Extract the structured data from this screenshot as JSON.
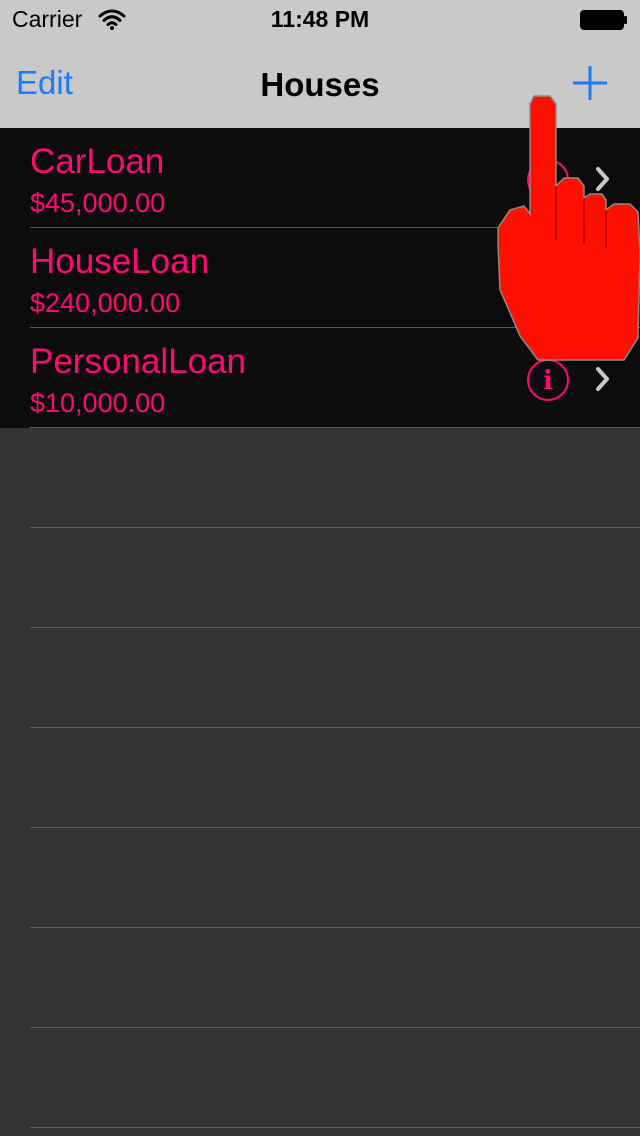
{
  "status_bar": {
    "carrier": "Carrier",
    "time": "11:48 PM",
    "icons": [
      "wifi-icon",
      "battery-icon"
    ]
  },
  "nav": {
    "edit_label": "Edit",
    "title": "Houses",
    "add_icon": "plus-icon"
  },
  "loans": [
    {
      "name": "CarLoan",
      "amount": "$45,000.00"
    },
    {
      "name": "HouseLoan",
      "amount": "$240,000.00"
    },
    {
      "name": "PersonalLoan",
      "amount": "$10,000.00"
    }
  ],
  "colors": {
    "accent": "#1a7cff",
    "text": "#ff0a73",
    "separator": "#2a55ff",
    "row_bg": "#0c0c0c",
    "empty_bg": "#333333",
    "pointer": "#ff1100"
  }
}
